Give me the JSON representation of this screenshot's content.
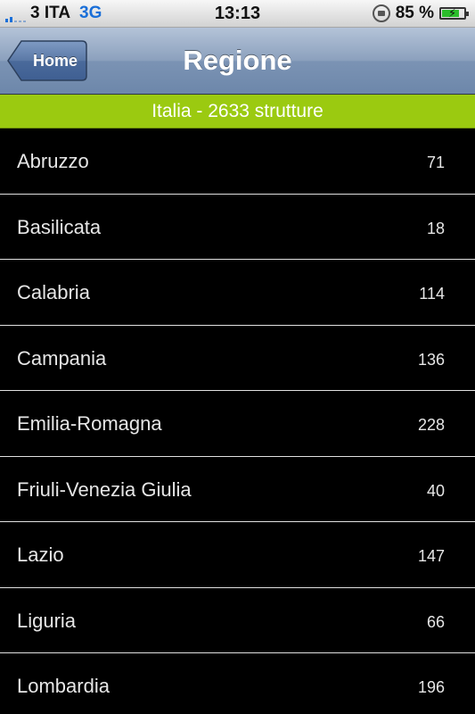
{
  "status_bar": {
    "carrier": "3 ITA",
    "network": "3G",
    "time": "13:13",
    "battery_percent": "85 %",
    "battery_level": 0.85,
    "icons": [
      "signal-icon",
      "rotation-lock-icon",
      "battery-charging-icon"
    ]
  },
  "nav": {
    "back_label": "Home",
    "title": "Regione"
  },
  "summary": {
    "text": "Italia - 2633 strutture",
    "color": "#9bca10"
  },
  "regions": [
    {
      "name": "Abruzzo",
      "count": "71"
    },
    {
      "name": "Basilicata",
      "count": "18"
    },
    {
      "name": "Calabria",
      "count": "114"
    },
    {
      "name": "Campania",
      "count": "136"
    },
    {
      "name": "Emilia-Romagna",
      "count": "228"
    },
    {
      "name": "Friuli-Venezia Giulia",
      "count": "40"
    },
    {
      "name": "Lazio",
      "count": "147"
    },
    {
      "name": "Liguria",
      "count": "66"
    },
    {
      "name": "Lombardia",
      "count": "196"
    }
  ]
}
